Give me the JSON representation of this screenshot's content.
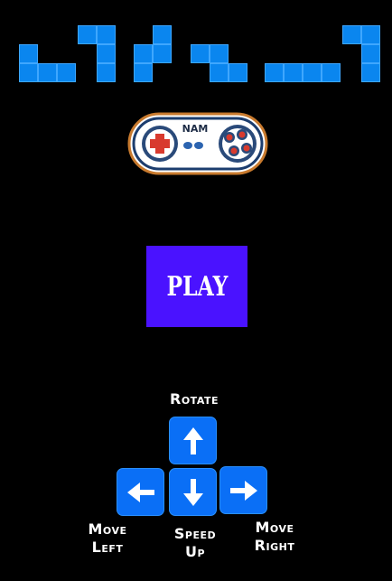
{
  "title_blocks": {
    "tile_color": "#0a86ef",
    "pieces": [
      "L-piece",
      "S-piece",
      "Z-piece",
      "J-piece"
    ]
  },
  "controller": {
    "brand_text": "NAM"
  },
  "play_button": {
    "label": "PLAY",
    "color": "#4a12ff"
  },
  "controls": {
    "rotate": {
      "label": "Rotate",
      "icon": "arrow-up-icon"
    },
    "left": {
      "label_line1": "Move",
      "label_line2": "Left",
      "icon": "arrow-left-icon"
    },
    "speed": {
      "label_line1": "Speed",
      "label_line2": "Up",
      "icon": "arrow-down-icon"
    },
    "right": {
      "label_line1": "Move",
      "label_line2": "Right",
      "icon": "arrow-right-icon"
    },
    "key_color": "#0a6ff6"
  }
}
